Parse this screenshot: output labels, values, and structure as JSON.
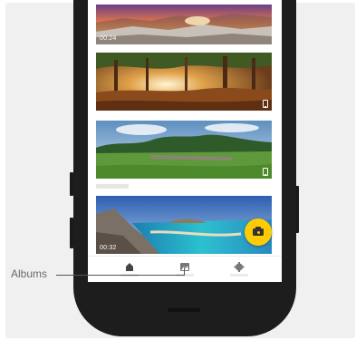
{
  "feed": {
    "items": [
      {
        "duration": "00:24",
        "type": "video"
      },
      {
        "type": "photo",
        "badge_icon": "phone-icon"
      },
      {
        "type": "photo",
        "badge_icon": "phone-icon"
      },
      {
        "duration": "00:32",
        "type": "video"
      }
    ]
  },
  "fab": {
    "icon": "camera-icon",
    "color": "#ffcb05"
  },
  "nav": {
    "items": [
      {
        "icon": "home-icon"
      },
      {
        "icon": "image-icon"
      },
      {
        "icon": "gear-icon"
      }
    ]
  },
  "callout": {
    "label": "Albums"
  }
}
